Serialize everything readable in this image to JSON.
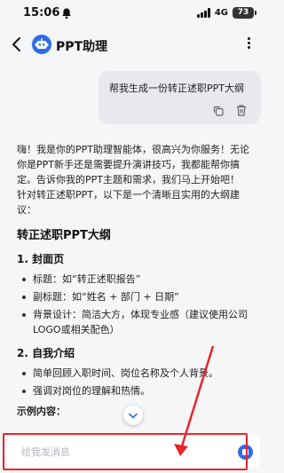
{
  "status_bar": {
    "time": "15:06",
    "network": "4G",
    "battery": "73"
  },
  "header": {
    "title": "PPT助理"
  },
  "user_message": {
    "text": "帮我生成一份转正述职PPT大纲"
  },
  "answer": {
    "intro": "嗨！我是你的PPT助理智能体，很高兴为你服务！无论你是PPT新手还是需要提升演讲技巧，我都能帮你搞定。告诉你我的PPT主题和需求，我们马上开始吧！",
    "lead": "针对转正述职PPT，以下是一个清晰且实用的大纲建议：",
    "outline_title": "转正述职PPT大纲",
    "section1_title": "1. 封面页",
    "section1_items": [
      "标题：如“转正述职报告”",
      "副标题：如“姓名 + 部门 + 日期”",
      "背景设计：简洁大方，体现专业感（建议使用公司LOGO或相关配色）"
    ],
    "section2_title": "2. 自我介绍",
    "section2_items": [
      "简单回顾入职时间、岗位名称及个人背景。",
      "强调对岗位的理解和热情。"
    ],
    "cut_text": "示例内容："
  },
  "composer": {
    "placeholder": "给我发消息"
  },
  "colors": {
    "accent": "#2f6bea",
    "annotation": "#e8262a",
    "bubble": "#e7e9ee",
    "background": "#f5f6f8"
  }
}
